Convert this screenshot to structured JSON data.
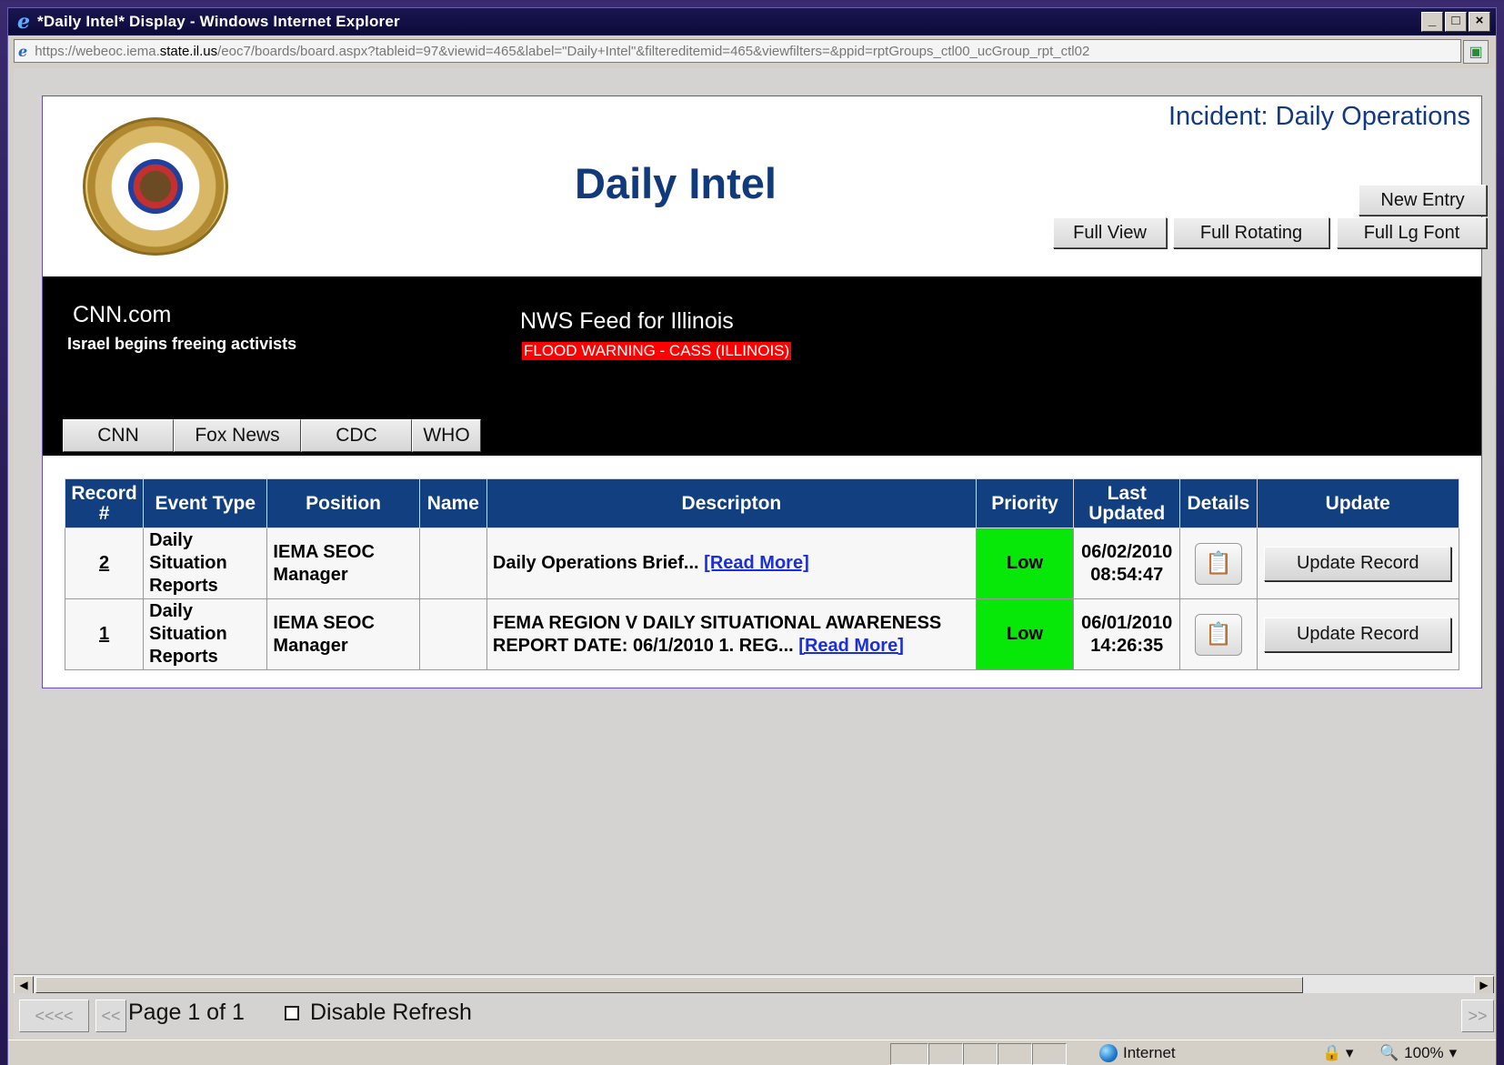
{
  "window": {
    "title": "*Daily Intel* Display - Windows Internet Explorer",
    "controls": [
      "_",
      "□",
      "×"
    ]
  },
  "address": {
    "url_prefix": "https://webeoc.iema.",
    "url_domain": "state.il.us",
    "url_path": "/eoc7/boards/board.aspx?tableid=97&viewid=465&label=\"Daily+Intel\"&filtereditemid=465&viewfilters=&ppid=rptGroups_ctl00_ucGroup_rpt_ctl02"
  },
  "header": {
    "incident": "Incident: Daily Operations",
    "title": "Daily Intel",
    "buttons": {
      "new_entry": "New Entry",
      "full_view": "Full View",
      "full_rotating": "Full Rotating",
      "full_lg_font": "Full Lg Font"
    }
  },
  "ticker": {
    "left_source": "CNN.com",
    "left_headline": "Israel begins freeing activists",
    "right_source": "NWS Feed for Illinois",
    "right_alert": "FLOOD WARNING - CASS (ILLINOIS)",
    "alert_color": "#ff0000",
    "tabs": [
      "CNN",
      "Fox News",
      "CDC",
      "WHO"
    ]
  },
  "table": {
    "headers": [
      "Record #",
      "Event Type",
      "Position",
      "Name",
      "Descripton",
      "Priority",
      "Last Updated",
      "Details",
      "Update"
    ],
    "header_color": "#123f80",
    "rows": [
      {
        "record": "2",
        "event_type": "Daily Situation Reports",
        "position": "IEMA SEOC Manager",
        "name": "",
        "description": "Daily Operations Brief...",
        "read_more": "[Read More]",
        "priority": "Low",
        "last_updated_date": "06/02/2010",
        "last_updated_time": "08:54:47",
        "details_icon": "clipboard-icon",
        "update_label": "Update Record"
      },
      {
        "record": "1",
        "event_type": "Daily Situation Reports",
        "position": "IEMA SEOC Manager",
        "name": "",
        "description": "FEMA REGION V DAILY SITUATIONAL AWARENESS REPORT DATE: 06/1/2010 1. REG...",
        "read_more": "[Read More]",
        "priority": "Low",
        "last_updated_date": "06/01/2010",
        "last_updated_time": "14:26:35",
        "details_icon": "clipboard-icon",
        "update_label": "Update Record"
      }
    ],
    "priority_color": "#08e808"
  },
  "nav": {
    "first": "<<<<",
    "prev": "<<",
    "page": "Page 1 of 1",
    "disable_refresh": "Disable Refresh",
    "next": ">>"
  },
  "status": {
    "zone": "Internet",
    "zoom": "100%"
  }
}
